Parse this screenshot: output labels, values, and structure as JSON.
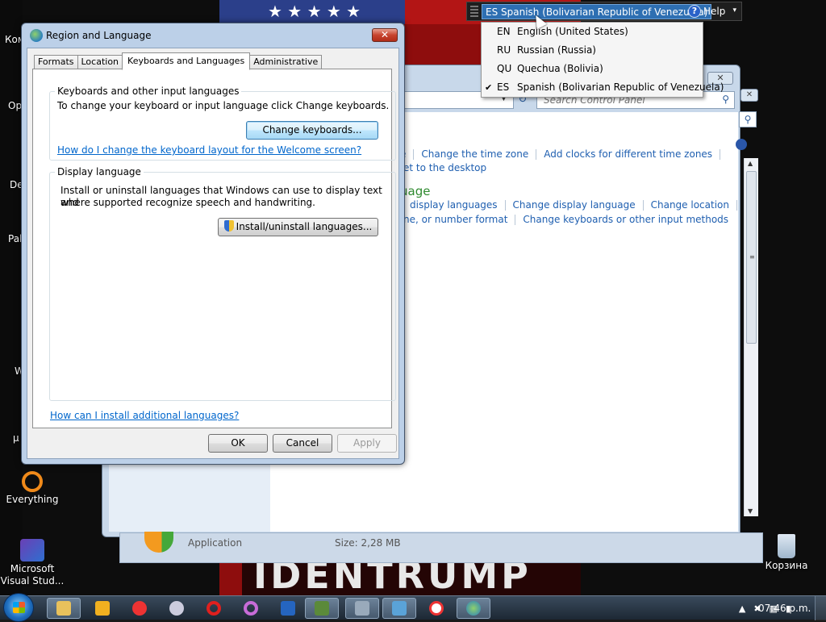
{
  "desktop": {
    "icons": [
      {
        "label": "Everything"
      },
      {
        "label": "Microsoft Visual Stud..."
      },
      {
        "label": "Корзина"
      }
    ],
    "edge_labels": [
      "Ком",
      "Op",
      "De",
      "Pal",
      "W",
      "µ"
    ]
  },
  "wallpaper": {
    "stars": "★ ★ ★ ★ ★",
    "text": "IDENTRUMP"
  },
  "language_bar": {
    "current": "ES Spanish (Bolivarian Republic of Venezuela)",
    "help_label": "Help",
    "help_glyph": "?",
    "options_glyph": "▾",
    "menu": [
      {
        "code": "EN",
        "name": "English (United States)",
        "checked": false
      },
      {
        "code": "RU",
        "name": "Russian (Russia)",
        "checked": false
      },
      {
        "code": "QU",
        "name": "Quechua (Bolivia)",
        "checked": false
      },
      {
        "code": "ES",
        "name": "Spanish (Bolivarian Republic of Venezuela)",
        "checked": true
      }
    ],
    "check_glyph": "✔"
  },
  "control_panel": {
    "search_placeholder": "Search Control Panel",
    "close_glyph": "✕",
    "links_row1": [
      "e",
      "Change the time zone",
      "Add clocks for different time zones"
    ],
    "links_row2": [
      "et to the desktop"
    ],
    "heading": "uage",
    "links_row3": [
      "display languages",
      "Change display language",
      "Change location"
    ],
    "links_row4": [
      "ne, or number format",
      "Change keyboards or other input methods"
    ]
  },
  "installer": {
    "app_label": "Application",
    "size_label": "Size: 2,28 MB"
  },
  "dialog": {
    "title": "Region and Language",
    "close_glyph": "✕",
    "tabs": [
      "Formats",
      "Location",
      "Keyboards and Languages",
      "Administrative"
    ],
    "active_tab": "Keyboards and Languages",
    "keyboards": {
      "caption": "Keyboards and other input languages",
      "text": "To change your keyboard or input language click Change keyboards.",
      "button": "Change keyboards...",
      "link": "How do I change the keyboard layout for the Welcome screen?"
    },
    "display_language": {
      "caption": "Display language",
      "text_line1": "Install or uninstall languages that Windows can use to display text and",
      "text_line2": "where supported recognize speech and handwriting.",
      "button": "Install/uninstall languages..."
    },
    "bottom_link": "How can I install additional languages?",
    "buttons": {
      "ok": "OK",
      "cancel": "Cancel",
      "apply": "Apply"
    }
  },
  "taskbar": {
    "clock": "07:46 p.m.",
    "tray_glyphs": [
      "▲",
      "✖",
      "▦",
      "▮"
    ]
  },
  "colors": {
    "link": "#0066cc",
    "cp_link": "#1f5fb0",
    "cp_heading": "#2f8a2f",
    "langbar_selected": "#2e6fb2"
  }
}
